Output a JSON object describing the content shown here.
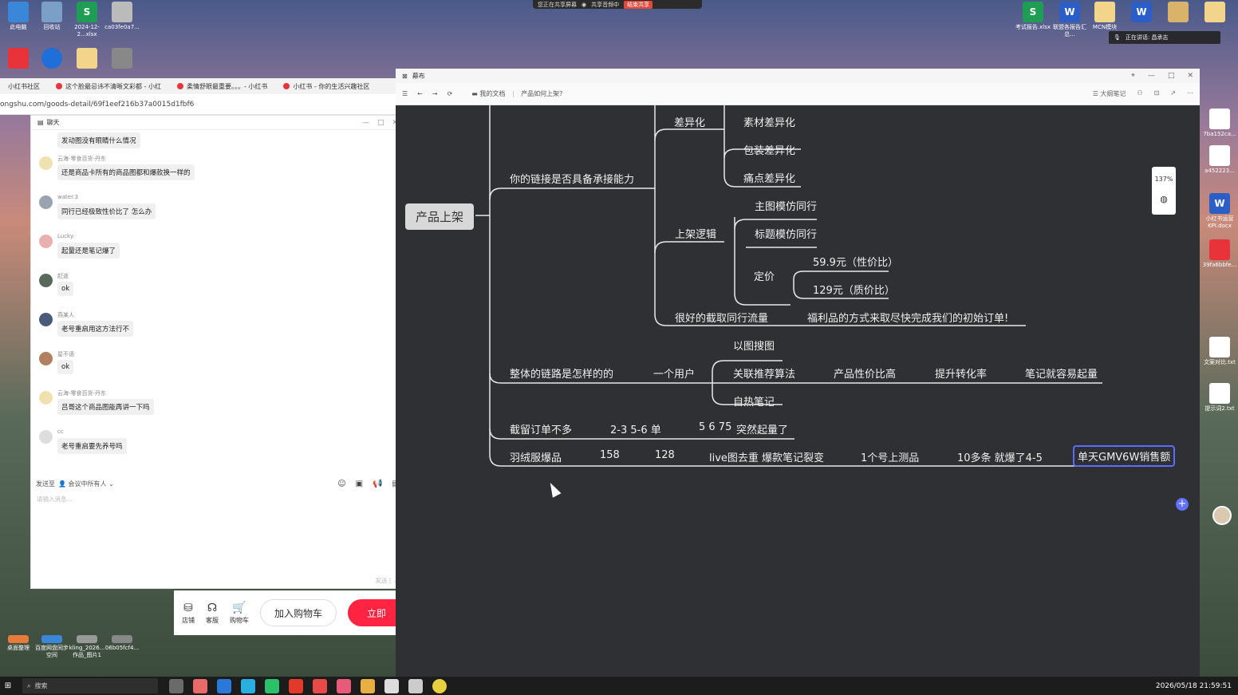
{
  "share_bar": {
    "sharing": "您正在共享屏幕",
    "audio": "共享音频中",
    "stop": "结束共享"
  },
  "desktop": {
    "top_left": [
      {
        "label": "此电脑",
        "color": "#3a86d8",
        "glyph": ""
      },
      {
        "label": "回收站",
        "color": "#7aa0c8",
        "glyph": ""
      },
      {
        "label": "2024-12-2...xlsx",
        "color": "#1f9d55",
        "glyph": "S"
      },
      {
        "label": "ca03fe0a7...",
        "color": "#bbbbbb",
        "glyph": ""
      }
    ],
    "second_row": [
      {
        "label": "",
        "color": "#e8333b",
        "glyph": ""
      },
      {
        "label": "",
        "color": "#1e6fd9",
        "glyph": ""
      },
      {
        "label": "",
        "color": "#f2d58a",
        "glyph": ""
      },
      {
        "label": "",
        "color": "#888888",
        "glyph": ""
      }
    ],
    "top_right": [
      {
        "label": "考试报告.xlsx",
        "color": "#1f9d55",
        "glyph": "S"
      },
      {
        "label": "联盟各报告汇总...",
        "color": "#2b5fc7",
        "glyph": "W"
      },
      {
        "label": "MCN模块",
        "color": "#f2d58a",
        "glyph": ""
      },
      {
        "label": "",
        "color": "#2b5fc7",
        "glyph": "W"
      },
      {
        "label": "",
        "color": "#d9b36a",
        "glyph": ""
      },
      {
        "label": "",
        "color": "#f2d58a",
        "glyph": ""
      }
    ],
    "bottom_left": [
      {
        "label": "桌面整理",
        "color": "#e87a3a"
      },
      {
        "label": "百度网盘同步空间",
        "color": "#3a86d8"
      },
      {
        "label": "kling_2026...作品_图片1",
        "color": "#999999"
      },
      {
        "label": "06b05fcf4...",
        "color": "#888888"
      }
    ],
    "right_strip": [
      {
        "label": "7ba152ca...",
        "color": "#ffffff"
      },
      {
        "label": "a452223...",
        "color": "#ffffff"
      },
      {
        "label": "小红书运营KPI.docx",
        "color": "#2b5fc7"
      },
      {
        "label": "39fa6bbfe...",
        "color": "#e8333b"
      },
      {
        "label": "文案对比.txt",
        "color": "#ffffff"
      },
      {
        "label": "提示词2.txt",
        "color": "#ffffff"
      }
    ],
    "speaking": "正在讲话: 昌承志"
  },
  "browser": {
    "tabs": [
      "小红书社区",
      "这个脸最忌讳不清晰文彩都 - 小红",
      "柔情舒眼最重要。。。- 小红书",
      "小红书 - 你的生活兴趣社区"
    ],
    "url": "ongshu.com/goods-detail/69f1eef216b37a0015d1fbf6"
  },
  "chat": {
    "title": "聊天",
    "messages": [
      {
        "name": "",
        "text": "发动图没有眼睛什么情况",
        "color": "#d9c9b0"
      },
      {
        "name": "云海-零食百货-丹东",
        "text": "还是商品卡所有的商品图都和爆款换一样的",
        "color": "#f0e2b0"
      },
      {
        "name": "water.3",
        "text": "同行已经极致性价比了 怎么办",
        "color": "#9aa4b0"
      },
      {
        "name": "Lucky.",
        "text": "起量还是笔记爆了",
        "color": "#e8b0b0"
      },
      {
        "name": "赶逝",
        "text": "ok",
        "color": "#5a6a5a"
      },
      {
        "name": "燕某人",
        "text": "老号重启用这方法行不",
        "color": "#4a5a7a"
      },
      {
        "name": "星不语",
        "text": "ok",
        "color": "#b08060"
      },
      {
        "name": "云海-零食百货-丹东",
        "text": "吕哥这个商品图能再讲一下吗",
        "color": "#f0e2b0"
      },
      {
        "name": "cc",
        "text": "老号重启要先养号吗",
        "color": "#dddddd"
      }
    ],
    "send_to_label": "发送至",
    "send_to_target": "会议中所有人",
    "placeholder": "请输入消息...",
    "send_label": "发送"
  },
  "shop": {
    "store": "店铺",
    "service": "客服",
    "cart": "购物车",
    "add_to_cart": "加入购物车",
    "buy_now": "立即"
  },
  "mindmap": {
    "window_title": "幕布",
    "breadcrumb_root": "我的文档",
    "breadcrumb_doc": "产品如何上架?",
    "toolbar_right": "大纲笔记",
    "zoom": "137%",
    "root": "产品上架",
    "n_link_ability": "你的链接是否具备承接能力",
    "n_diff": "差异化",
    "n_diff_material": "素材差异化",
    "n_diff_pack": "包装差异化",
    "n_diff_pain": "痛点差异化",
    "n_logic": "上架逻辑",
    "n_logic_main": "主图模仿同行",
    "n_logic_title": "标题模仿同行",
    "n_price": "定价",
    "n_price_1": "59.9元（性价比）",
    "n_price_2": "129元（质价比）",
    "n_traffic": "很好的截取同行流量",
    "n_traffic_detail": "福利品的方式来取尽快完成我们的初始订单!",
    "n_chain": "整体的链路是怎样的的",
    "n_user": "一个用户",
    "n_img_search": "以图搜图",
    "n_algo": "关联推荐算法",
    "n_cost": "产品性价比高",
    "n_conv": "提升转化率",
    "n_note_easy": "笔记就容易起量",
    "n_self_note": "自热笔记",
    "n_orders": "截留订单不多",
    "n_orders_a": "2-3  5-6 单",
    "n_orders_b": "5 6 75",
    "n_orders_c": "突然起量了",
    "n_down": "羽绒服爆品",
    "n_down_158": "158",
    "n_down_128": "128",
    "n_down_live": "live图去重 爆款笔记裂变",
    "n_down_test": "1个号上测品",
    "n_down_10": "10多条 就爆了4-5",
    "n_down_gmv": "单天GMV6W销售额"
  },
  "taskbar": {
    "search": "搜索",
    "clock": "2026/05/18 21:59:51",
    "apps": [
      "#6a6a6a",
      "#e86a6a",
      "#2a78d8",
      "#2ab0e0",
      "#2bc06a",
      "#e03a2a",
      "#e84a4a",
      "#e85a7a",
      "#e8b040",
      "#dddddd",
      "#cccccc",
      "#e8d040"
    ]
  },
  "colors": {
    "mindmap_bg": "#2f3033",
    "line": "#e8e8e8",
    "selected_border": "#5b6cff",
    "buy_red": "#ff2442"
  }
}
